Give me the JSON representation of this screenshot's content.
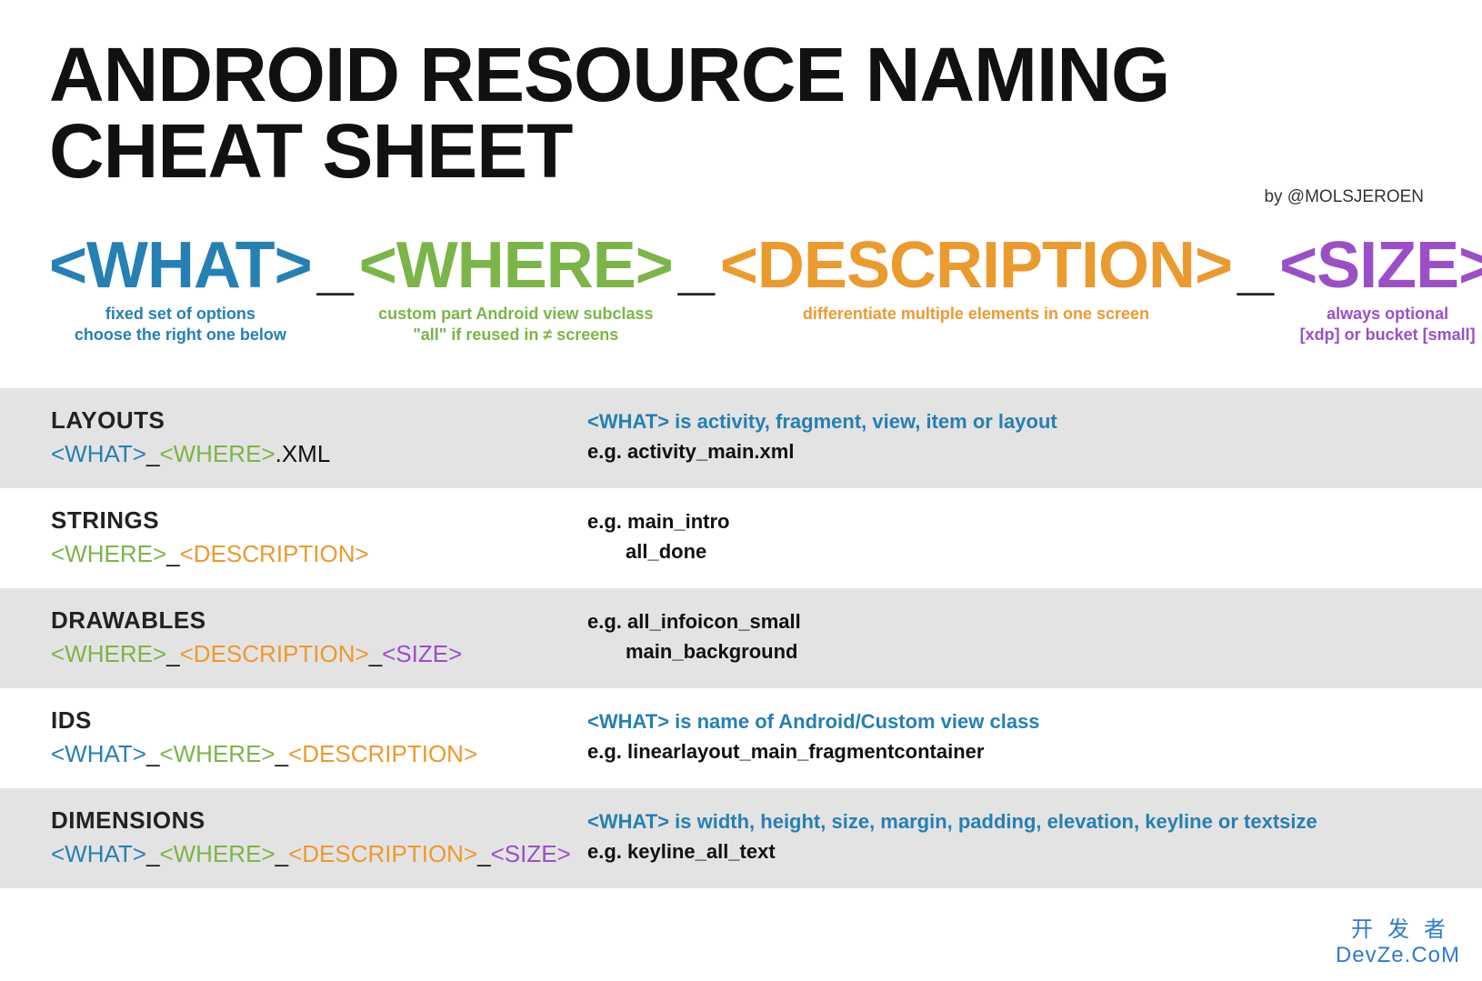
{
  "title": "ANDROID RESOURCE NAMING CHEAT SHEET",
  "byline": "by @MOLSJEROEN",
  "formula": {
    "what": {
      "token": "<WHAT>",
      "desc1": "fixed set of options",
      "desc2": "choose the right one below"
    },
    "where": {
      "token": "<WHERE>",
      "desc1": "custom part Android view subclass",
      "desc2": "\"all\" if reused in ≠ screens"
    },
    "desc": {
      "token": "<DESCRIPTION>",
      "desc1": "differentiate multiple elements in one screen",
      "desc2": ""
    },
    "size": {
      "token": "<SIZE>",
      "desc1": "always optional",
      "desc2": "[xdp] or bucket [small]"
    },
    "sep": "_"
  },
  "rows": [
    {
      "cat": "LAYOUTS",
      "pattern": [
        {
          "text": "<WHAT>",
          "cls": "c-what"
        },
        {
          "text": "_",
          "cls": "c-black"
        },
        {
          "text": "<WHERE>",
          "cls": "c-where"
        },
        {
          "text": ".XML",
          "cls": "c-black"
        }
      ],
      "note": "<WHAT> is activity, fragment, view, item or layout",
      "eg1": "e.g. activity_main.xml",
      "eg2": ""
    },
    {
      "cat": "STRINGS",
      "pattern": [
        {
          "text": "<WHERE>",
          "cls": "c-where"
        },
        {
          "text": "_",
          "cls": "c-black"
        },
        {
          "text": "<DESCRIPTION>",
          "cls": "c-desc"
        }
      ],
      "note": "",
      "eg1": "e.g. main_intro",
      "eg2": "all_done"
    },
    {
      "cat": "DRAWABLES",
      "pattern": [
        {
          "text": "<WHERE>",
          "cls": "c-where"
        },
        {
          "text": "_",
          "cls": "c-black"
        },
        {
          "text": "<DESCRIPTION>",
          "cls": "c-desc"
        },
        {
          "text": "_",
          "cls": "c-black"
        },
        {
          "text": "<SIZE>",
          "cls": "c-size"
        }
      ],
      "note": "",
      "eg1": "e.g. all_infoicon_small",
      "eg2": "main_background"
    },
    {
      "cat": "IDS",
      "pattern": [
        {
          "text": "<WHAT>",
          "cls": "c-what"
        },
        {
          "text": "_",
          "cls": "c-black"
        },
        {
          "text": "<WHERE>",
          "cls": "c-where"
        },
        {
          "text": "_",
          "cls": "c-black"
        },
        {
          "text": "<DESCRIPTION>",
          "cls": "c-desc"
        }
      ],
      "note": "<WHAT> is name of Android/Custom view class",
      "eg1": "e.g. linearlayout_main_fragmentcontainer",
      "eg2": ""
    },
    {
      "cat": "DIMENSIONS",
      "pattern": [
        {
          "text": "<WHAT>",
          "cls": "c-what"
        },
        {
          "text": "_",
          "cls": "c-black"
        },
        {
          "text": "<WHERE>",
          "cls": "c-where"
        },
        {
          "text": "_",
          "cls": "c-black"
        },
        {
          "text": "<DESCRIPTION>",
          "cls": "c-desc"
        },
        {
          "text": "_",
          "cls": "c-black"
        },
        {
          "text": "<SIZE>",
          "cls": "c-size"
        }
      ],
      "note": "<WHAT> is width, height, size, margin, padding, elevation, keyline or textsize",
      "eg1": "e.g. keyline_all_text",
      "eg2": ""
    }
  ],
  "watermark": {
    "line1": "开发者",
    "line2": "DevZe.CoM"
  }
}
